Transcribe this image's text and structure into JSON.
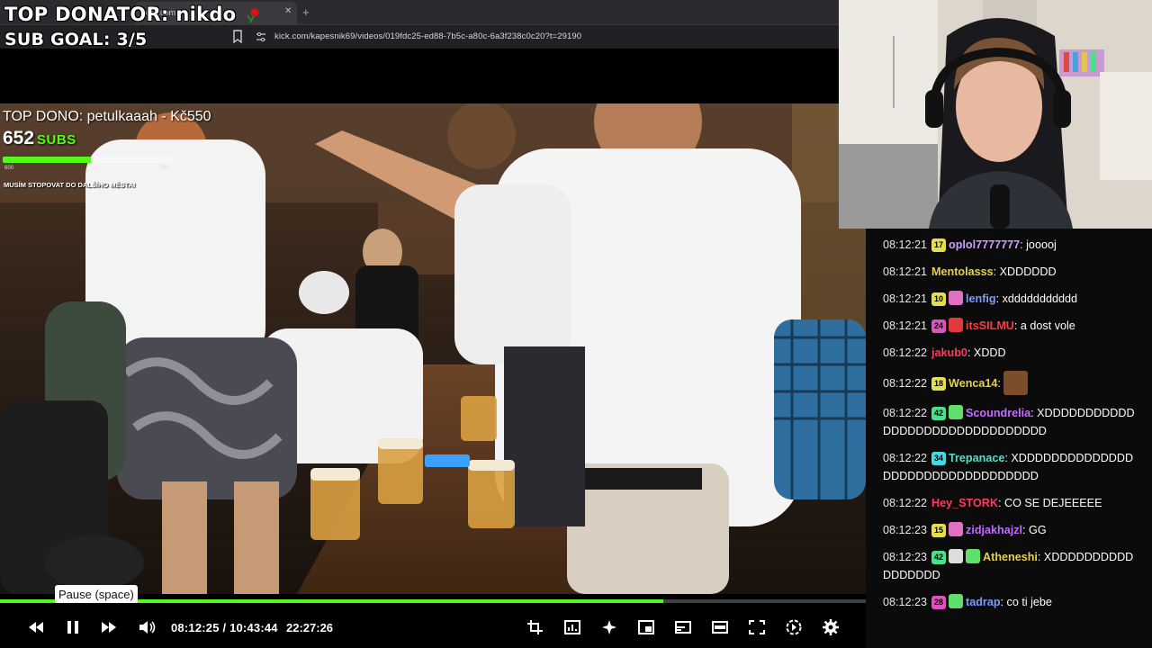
{
  "browser": {
    "tab_title": "kick.com",
    "url": "kick.com/kapesnik69/videos/019fdc25-ed88-7b5c-a80c-6a3f238c0c20?t=29190"
  },
  "overlay": {
    "top_donator": "TOP DONATOR: nikdo",
    "sub_goal": "SUB GOAL: 3/5",
    "top_dono": "TOP DONO: petulkaaah - Kč550",
    "subs_count": "652",
    "subs_label": "SUBS",
    "subs_min": "600",
    "subs_max": "700",
    "subs_progress_fraction": 0.52,
    "subs_message": "MUSÍM STOPOVAT DO DALŠÍHO MĚSTA!"
  },
  "chat": {
    "messages": [
      {
        "time": "08:12:21",
        "badge": "17",
        "badge_color": "#e5e04a",
        "user": "oplol7777777",
        "user_color": "#c9a0ff",
        "text": ": jooooj"
      },
      {
        "time": "08:12:21",
        "user": "Mentolasss",
        "user_color": "#e5d24a",
        "text": ": XDDDDDD"
      },
      {
        "time": "08:12:21",
        "badge": "10",
        "badge_color": "#e5e04a",
        "icon": "sub-gift-icon",
        "icon_color": "#e070c0",
        "user": "lenfig",
        "user_color": "#7a9dff",
        "text": ": xddddddddddd"
      },
      {
        "time": "08:12:21",
        "badge": "24",
        "badge_color": "#e050c0",
        "icon": "crown-icon",
        "icon_color": "#e03a3a",
        "user": "itsSILMU",
        "user_color": "#ff3b3b",
        "text": ": a dost vole"
      },
      {
        "time": "08:12:22",
        "user": "jakub0",
        "user_color": "#ff3b5c",
        "text": ": XDDD"
      },
      {
        "time": "08:12:22",
        "badge": "18",
        "badge_color": "#e5e04a",
        "user": "Wenca14",
        "user_color": "#e5d24a",
        "text": ":",
        "emote": "face-emote"
      },
      {
        "time": "08:12:22",
        "badge": "42",
        "badge_color": "#4ae08a",
        "icon": "sub-gift-icon",
        "icon_color": "#5fe06a",
        "user": "Scoundrelia",
        "user_color": "#c46cff",
        "text": ": XDDDDDDDDDDDDDDDDDDDDDDDDDDDDDDD"
      },
      {
        "time": "08:12:22",
        "badge": "34",
        "badge_color": "#4ad8e0",
        "user": "Trepanace",
        "user_color": "#53e0c8",
        "text": ": XDDDDDDDDDDDDDDDDDDDDDDDDDDDDDDDDD"
      },
      {
        "time": "08:12:22",
        "user": "Hey_STORK",
        "user_color": "#ff3b5c",
        "text": ": CO SE DEJEEEEE"
      },
      {
        "time": "08:12:23",
        "badge": "15",
        "badge_color": "#e5e04a",
        "icon": "sub-gift-icon",
        "icon_color": "#e070c0",
        "user": "zidjakhajzl",
        "user_color": "#c46cff",
        "text": ": GG"
      },
      {
        "time": "08:12:23",
        "badge": "42",
        "badge_color": "#4ae08a",
        "icon": "emote-badge-icon",
        "icon_color": "#dddddd",
        "icon2": "sub-gift-icon",
        "icon2_color": "#5fe06a",
        "user": "Atheneshi",
        "user_color": "#e5d24a",
        "text": ": XDDDDDDDDDDDDDDDDD"
      },
      {
        "time": "08:12:23",
        "badge": "28",
        "badge_color": "#e050c0",
        "icon": "sub-gift-icon",
        "icon_color": "#5fe06a",
        "user": "tadrap",
        "user_color": "#7a9dff",
        "text": ": co ti jebe"
      }
    ]
  },
  "player": {
    "current_time": "08:12:25",
    "total_time": "10:43:44",
    "time_display": "08:12:25 / 10:43:44",
    "clock": "22:27:26",
    "progress_fraction": 0.766,
    "tooltip": "Pause (space)",
    "accent_color": "#53fc18",
    "icons": [
      "rewind-icon",
      "pause-icon",
      "fast-forward-icon",
      "volume-icon",
      "crop-icon",
      "stats-icon",
      "sparkle-icon",
      "miniplayer-icon",
      "cast-icon",
      "theater-icon",
      "fullscreen-icon",
      "speed-icon",
      "settings-icon"
    ]
  }
}
